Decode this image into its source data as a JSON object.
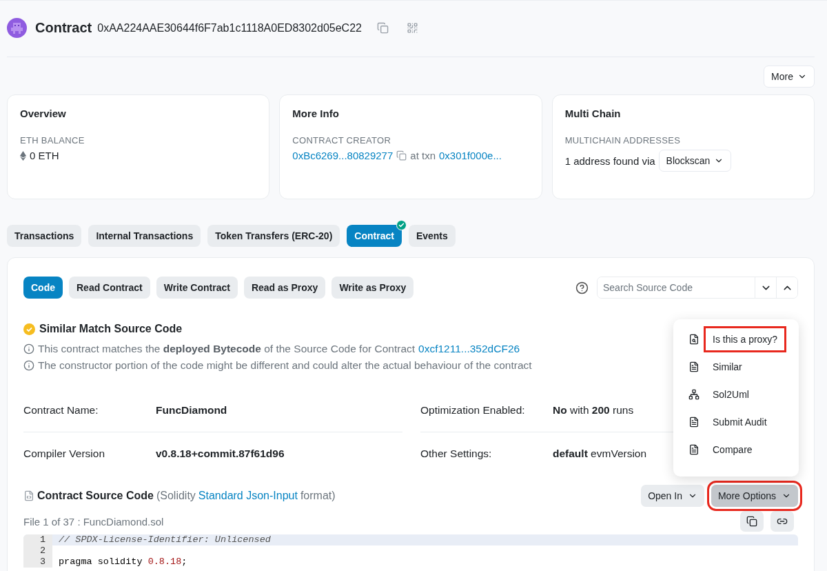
{
  "header": {
    "title": "Contract",
    "address": "0xAA224AAE30644f6F7ab1c1118A0ED8302d05eC22"
  },
  "more_button": "More",
  "cards": [
    {
      "kind": "balance",
      "title": "Overview",
      "label": "ETH BALANCE",
      "value": "0 ETH"
    },
    {
      "kind": "creator",
      "title": "More Info",
      "label": "CONTRACT CREATOR",
      "creator": "0xBc6269...80829277",
      "connector": "at txn",
      "txn": "0x301f000e..."
    },
    {
      "kind": "multichain",
      "title": "Multi Chain",
      "label": "MULTICHAIN ADDRESSES",
      "text": "1 address found via",
      "dropdown": "Blockscan"
    }
  ],
  "tabs": [
    {
      "label": "Transactions",
      "selected": false,
      "verified": false
    },
    {
      "label": "Internal Transactions",
      "selected": false,
      "verified": false
    },
    {
      "label": "Token Transfers (ERC-20)",
      "selected": false,
      "verified": false
    },
    {
      "label": "Contract",
      "selected": true,
      "verified": true
    },
    {
      "label": "Events",
      "selected": false,
      "verified": false
    }
  ],
  "sub_tabs": [
    {
      "label": "Code",
      "selected": true
    },
    {
      "label": "Read Contract",
      "selected": false
    },
    {
      "label": "Write Contract",
      "selected": false
    },
    {
      "label": "Read as Proxy",
      "selected": false
    },
    {
      "label": "Write as Proxy",
      "selected": false
    }
  ],
  "search": {
    "placeholder": "Search Source Code"
  },
  "match": {
    "title": "Similar Match Source Code",
    "notes": [
      {
        "text": "This contract matches the **deployed Bytecode** of the Source Code for Contract",
        "link": "0xcf1211...352dCF26"
      },
      {
        "text": "The constructor portion of the code might be different and could alter the actual behaviour of the contract"
      }
    ]
  },
  "details": [
    [
      {
        "label": "Contract Name:",
        "value": "FuncDiamond",
        "emphasis": true
      },
      {
        "label": "Compiler Version",
        "value": "v0.8.18+commit.87f61d96",
        "emphasis": true
      }
    ],
    [
      {
        "label": "Optimization Enabled:",
        "value": "**No** with **200** runs",
        "emphasis": false
      },
      {
        "label": "Other Settings:",
        "value": "**default** evmVersion",
        "emphasis": false
      }
    ]
  ],
  "source": {
    "title": "Contract Source Code",
    "format_prefix": "(Solidity",
    "format_link": "Standard Json-Input",
    "format_suffix": "format)",
    "open_in": "Open In",
    "more_options": {
      "label": "More Options",
      "highlighted": true
    },
    "file_label": "File 1 of 37 : FuncDiamond.sol"
  },
  "code_lines": [
    {
      "number": "1",
      "selected": true,
      "segments": [
        {
          "kind": "comment",
          "text": "// SPDX-License-Identifier: Unlicensed"
        }
      ]
    },
    {
      "number": "2",
      "selected": false
    },
    {
      "number": "3",
      "selected": false,
      "segments": [
        {
          "kind": "plain",
          "text": "pragma solidity "
        },
        {
          "kind": "number",
          "text": "0.8.18"
        },
        {
          "kind": "plain",
          "text": ";"
        }
      ]
    }
  ],
  "menu": [
    {
      "kind": "search-doc",
      "label": "Is this a proxy?",
      "highlighted": true
    },
    {
      "kind": "doc",
      "label": "Similar",
      "highlighted": false
    },
    {
      "kind": "diagram",
      "label": "Sol2Uml",
      "highlighted": false
    },
    {
      "kind": "doc",
      "label": "Submit Audit",
      "highlighted": false
    },
    {
      "kind": "doc",
      "label": "Compare",
      "highlighted": false
    }
  ]
}
